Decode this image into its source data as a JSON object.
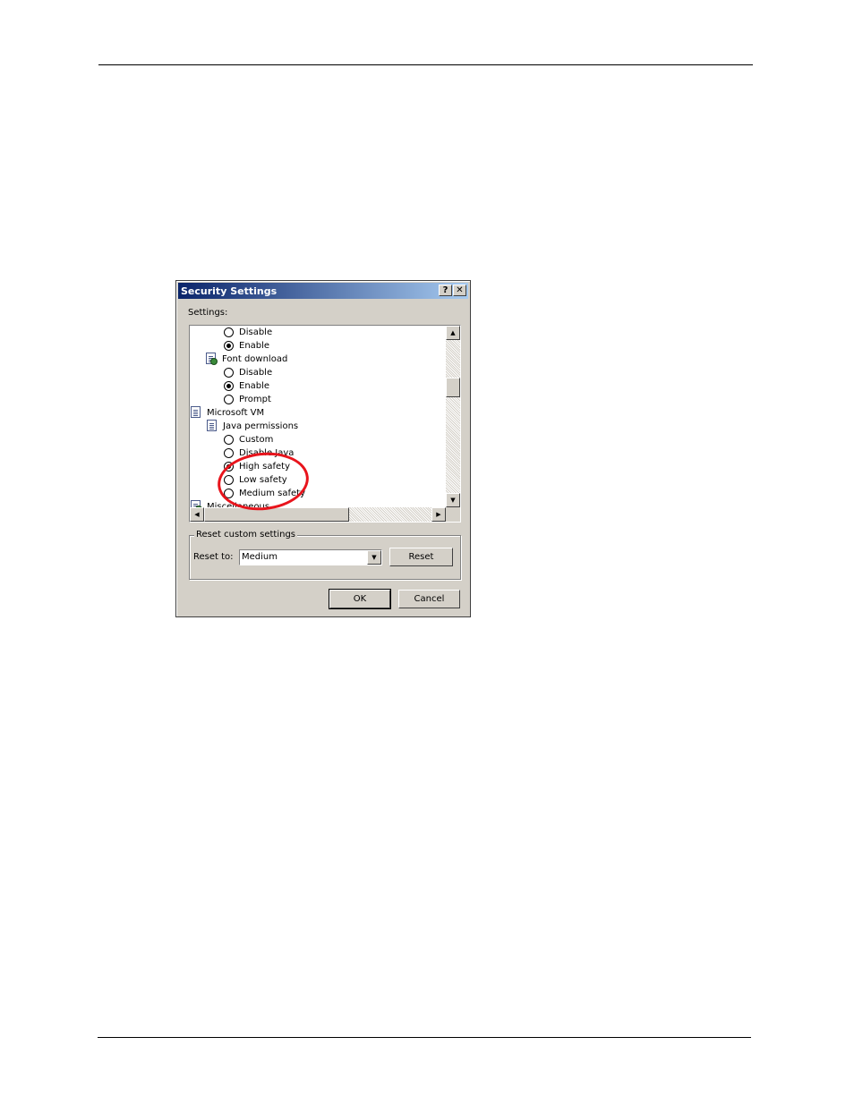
{
  "dialog": {
    "title": "Security Settings",
    "help_button": "?",
    "close_button": "✕",
    "settings_label": "Settings:",
    "tree_items": [
      {
        "kind": "radio",
        "label": "Disable",
        "checked": false
      },
      {
        "kind": "radio",
        "label": "Enable",
        "checked": true
      },
      {
        "kind": "category",
        "label": "Font download",
        "icon": "settings-page-icon"
      },
      {
        "kind": "radio",
        "label": "Disable",
        "checked": false
      },
      {
        "kind": "radio",
        "label": "Enable",
        "checked": true
      },
      {
        "kind": "radio",
        "label": "Prompt",
        "checked": false
      },
      {
        "kind": "category",
        "label": "Microsoft VM",
        "icon": "document-icon"
      },
      {
        "kind": "category",
        "label": "Java permissions",
        "icon": "document-icon"
      },
      {
        "kind": "radio",
        "label": "Custom",
        "checked": false
      },
      {
        "kind": "radio",
        "label": "Disable Java",
        "checked": false
      },
      {
        "kind": "radio",
        "label": "High safety",
        "checked": true
      },
      {
        "kind": "radio",
        "label": "Low safety",
        "checked": false
      },
      {
        "kind": "radio",
        "label": "Medium safety",
        "checked": false
      },
      {
        "kind": "category",
        "label": "Miscellaneous",
        "icon": "settings-page-icon"
      }
    ],
    "reset_group": {
      "legend": "Reset custom settings",
      "reset_to_label": "Reset to:",
      "selected": "Medium",
      "reset_button": "Reset"
    },
    "ok_button": "OK",
    "cancel_button": "Cancel"
  },
  "colors": {
    "annotation": "#e8141c",
    "titlebar_start": "#0a246a",
    "titlebar_end": "#a6caf0",
    "dialog_face": "#d4d0c8"
  }
}
